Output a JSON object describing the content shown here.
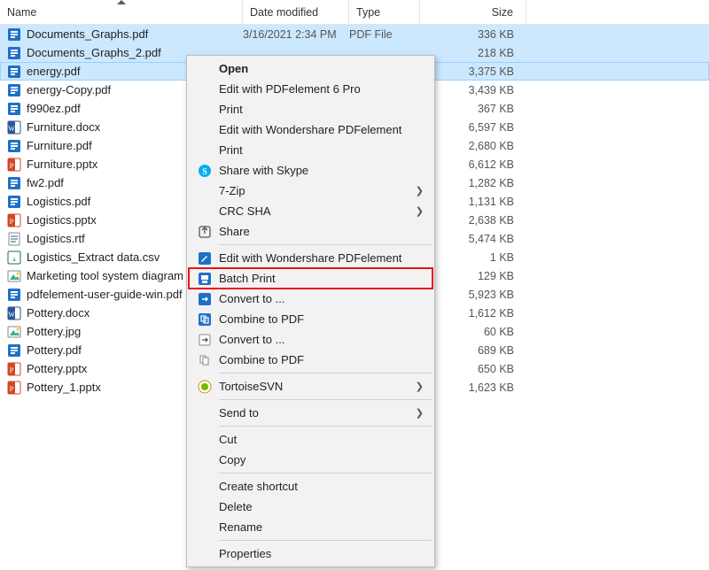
{
  "columns": {
    "name": "Name",
    "date": "Date modified",
    "type": "Type",
    "size": "Size"
  },
  "files": [
    {
      "name": "Documents_Graphs.pdf",
      "date": "3/16/2021 2:34 PM",
      "type": "PDF File",
      "size": "336 KB",
      "icon": "pdf",
      "selected": true
    },
    {
      "name": "Documents_Graphs_2.pdf",
      "date": "",
      "type": "",
      "size": "218 KB",
      "icon": "pdf",
      "selected": true
    },
    {
      "name": "energy.pdf",
      "date": "",
      "type": "",
      "size": "3,375 KB",
      "icon": "pdf",
      "selected": true,
      "focus": true
    },
    {
      "name": "energy-Copy.pdf",
      "date": "",
      "type": "",
      "size": "3,439 KB",
      "icon": "pdf"
    },
    {
      "name": "f990ez.pdf",
      "date": "",
      "type": "",
      "size": "367 KB",
      "icon": "pdf"
    },
    {
      "name": "Furniture.docx",
      "date": "",
      "type": "",
      "size": "6,597 KB",
      "icon": "docx"
    },
    {
      "name": "Furniture.pdf",
      "date": "",
      "type": "",
      "size": "2,680 KB",
      "icon": "pdf"
    },
    {
      "name": "Furniture.pptx",
      "date": "",
      "type": "",
      "size": "6,612 KB",
      "icon": "pptx"
    },
    {
      "name": "fw2.pdf",
      "date": "",
      "type": "",
      "size": "1,282 KB",
      "icon": "pdf"
    },
    {
      "name": "Logistics.pdf",
      "date": "",
      "type": "",
      "size": "1,131 KB",
      "icon": "pdf"
    },
    {
      "name": "Logistics.pptx",
      "date": "",
      "type": "",
      "size": "2,638 KB",
      "icon": "pptx"
    },
    {
      "name": "Logistics.rtf",
      "date": "",
      "type": "",
      "size": "5,474 KB",
      "icon": "rtf"
    },
    {
      "name": "Logistics_Extract data.csv",
      "date": "",
      "type": "",
      "size": "1 KB",
      "icon": "csv"
    },
    {
      "name": "Marketing tool system diagram",
      "date": "",
      "type": "",
      "size": "129 KB",
      "icon": "img"
    },
    {
      "name": "pdfelement-user-guide-win.pdf",
      "date": "",
      "type": "",
      "size": "5,923 KB",
      "icon": "pdf"
    },
    {
      "name": "Pottery.docx",
      "date": "",
      "type": "",
      "size": "1,612 KB",
      "icon": "docx"
    },
    {
      "name": "Pottery.jpg",
      "date": "",
      "type": "",
      "size": "60 KB",
      "icon": "img"
    },
    {
      "name": "Pottery.pdf",
      "date": "",
      "type": "",
      "size": "689 KB",
      "icon": "pdf"
    },
    {
      "name": "Pottery.pptx",
      "date": "",
      "type": "",
      "size": "650 KB",
      "icon": "pptx"
    },
    {
      "name": "Pottery_1.pptx",
      "date": "",
      "type": "",
      "size": "1,623 KB",
      "icon": "pptx"
    }
  ],
  "menu": [
    {
      "label": "Open",
      "bold": true
    },
    {
      "label": "Edit with PDFelement 6 Pro"
    },
    {
      "label": "Print"
    },
    {
      "label": "Edit with Wondershare PDFelement"
    },
    {
      "label": "Print"
    },
    {
      "label": "Share with Skype",
      "icon": "skype"
    },
    {
      "label": "7-Zip",
      "submenu": true
    },
    {
      "label": "CRC SHA",
      "submenu": true
    },
    {
      "label": "Share",
      "icon": "share"
    },
    {
      "sep": true
    },
    {
      "label": "Edit with Wondershare PDFelement",
      "icon": "ws-edit"
    },
    {
      "label": "Batch Print",
      "icon": "ws-print",
      "highlight": true
    },
    {
      "label": "Convert to ...",
      "icon": "ws-convert"
    },
    {
      "label": "Combine to PDF",
      "icon": "ws-combine"
    },
    {
      "label": "Convert to ...",
      "icon": "ws-convert2"
    },
    {
      "label": "Combine to PDF",
      "icon": "ws-combine2"
    },
    {
      "sep": true
    },
    {
      "label": "TortoiseSVN",
      "icon": "tsvn",
      "submenu": true
    },
    {
      "sep": true
    },
    {
      "label": "Send to",
      "submenu": true
    },
    {
      "sep": true
    },
    {
      "label": "Cut"
    },
    {
      "label": "Copy"
    },
    {
      "sep": true
    },
    {
      "label": "Create shortcut"
    },
    {
      "label": "Delete"
    },
    {
      "label": "Rename"
    },
    {
      "sep": true
    },
    {
      "label": "Properties"
    }
  ]
}
